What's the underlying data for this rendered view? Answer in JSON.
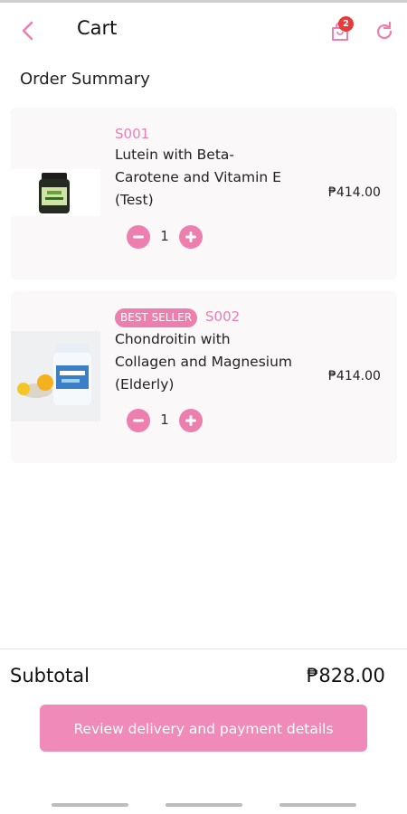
{
  "header": {
    "title": "Cart",
    "cart_badge_count": "2",
    "back_icon": "chevron-left-icon",
    "cart_icon": "shopping-bag-icon",
    "refresh_icon": "refresh-icon"
  },
  "order_summary": {
    "title": "Order Summary"
  },
  "items": [
    {
      "sku": "S001",
      "name": "Lutein with Beta-Carotene and Vitamin E (Test)",
      "price": "₱414.00",
      "quantity": "1",
      "badge": ""
    },
    {
      "sku": "S002",
      "name": "Chondroitin with Collagen and Magnesium (Elderly)",
      "price": "₱414.00",
      "quantity": "1",
      "badge": "BEST SELLER"
    }
  ],
  "footer": {
    "subtotal_label": "Subtotal",
    "subtotal_value": "₱828.00",
    "review_button": "Review delivery and payment details"
  },
  "colors": {
    "accent_pink": "#ec7fae",
    "button_pink": "#f08ab8",
    "badge_red": "#e83a3a"
  }
}
